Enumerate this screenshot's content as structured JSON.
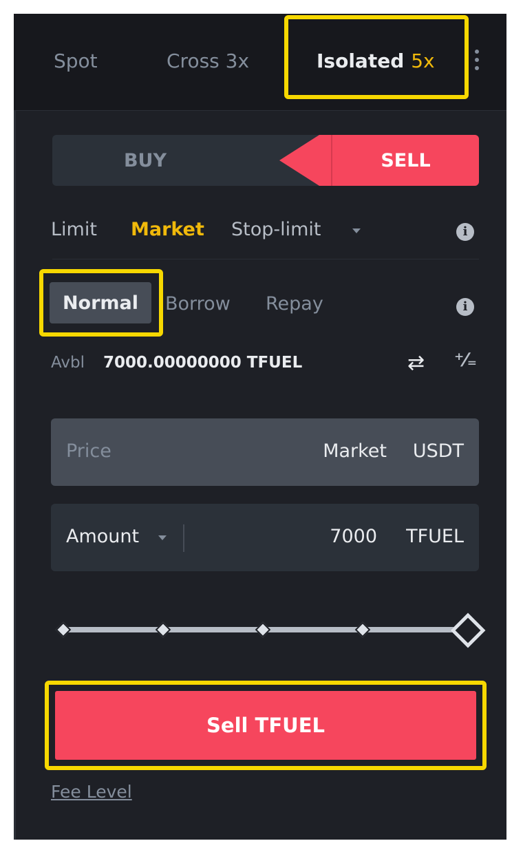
{
  "margin_tabs": {
    "spot": "Spot",
    "cross": "Cross 3x",
    "isolated": "Isolated",
    "isolated_leverage": "5x"
  },
  "side": {
    "buy": "BUY",
    "sell": "SELL",
    "selected": "SELL"
  },
  "order_types": {
    "limit": "Limit",
    "market": "Market",
    "stop_limit": "Stop-limit",
    "selected": "Market"
  },
  "modes": {
    "normal": "Normal",
    "borrow": "Borrow",
    "repay": "Repay",
    "selected": "Normal"
  },
  "available": {
    "label": "Avbl",
    "value": "7000.00000000 TFUEL"
  },
  "price_field": {
    "label": "Price",
    "value": "Market",
    "unit": "USDT"
  },
  "amount_field": {
    "label": "Amount",
    "value": "7000",
    "unit": "TFUEL"
  },
  "slider": {
    "level_percent": 100,
    "stops": [
      0,
      25,
      50,
      75,
      100
    ]
  },
  "submit": {
    "label": "Sell TFUEL"
  },
  "fee_level": "Fee Level",
  "icons": {
    "info": "i",
    "swap": "⇄",
    "percent": "⁺⁄₌"
  },
  "colors": {
    "accent": "#f0b90b",
    "sell": "#f6465d",
    "highlight": "#f7d800",
    "background": "#1e2026"
  }
}
